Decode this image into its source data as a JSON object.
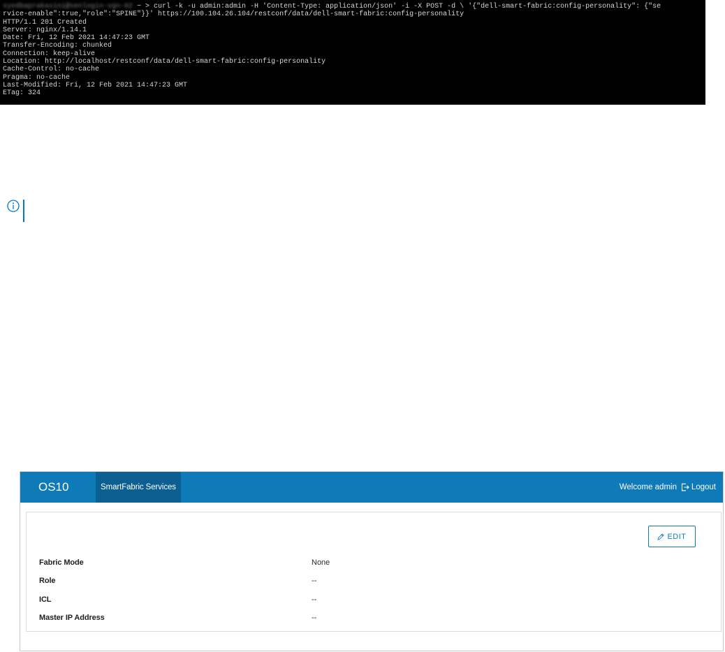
{
  "terminal": {
    "prompt_blurred": "syedbaprakasini@senlogin-vgn-02",
    "lines": [
      " ~ > curl -k -u admin:admin -H 'Content-Type: application/json' -i -X POST -d \\ '{\"dell-smart-fabric:config-personality\": {\"se",
      "rvice-enable\":true,\"role\":\"SPINE\"}}' https://100.104.26.104/restconf/data/dell-smart-fabric:config-personality",
      "HTTP/1.1 201 Created",
      "Server: nginx/1.14.1",
      "Date: Fri, 12 Feb 2021 14:47:23 GMT",
      "Transfer-Encoding: chunked",
      "Connection: keep-alive",
      "Location: http://localhost/restconf/data/dell-smart-fabric:config-personality",
      "Cache-Control: no-cache",
      "Pragma: no-cache",
      "Last-Modified: Fri, 12 Feb 2021 14:47:23 GMT",
      "ETag: 324"
    ]
  },
  "icons": {
    "note": "info-circle-icon",
    "logout": "logout-icon",
    "edit": "pencil-icon"
  },
  "colors": {
    "topbar": "#0f7ab8",
    "active_tab": "#0b5f91",
    "note_accent": "#0076ce",
    "terminal_bg": "#000000"
  },
  "os10": {
    "brand": "OS10",
    "nav_tab": "SmartFabric Services",
    "welcome": "Welcome admin",
    "logout": "Logout",
    "edit_button": "EDIT",
    "fields": [
      {
        "label": "Fabric Mode",
        "value": "None"
      },
      {
        "label": "Role",
        "value": "--"
      },
      {
        "label": "ICL",
        "value": "--"
      },
      {
        "label": "Master IP Address",
        "value": "--"
      }
    ]
  }
}
